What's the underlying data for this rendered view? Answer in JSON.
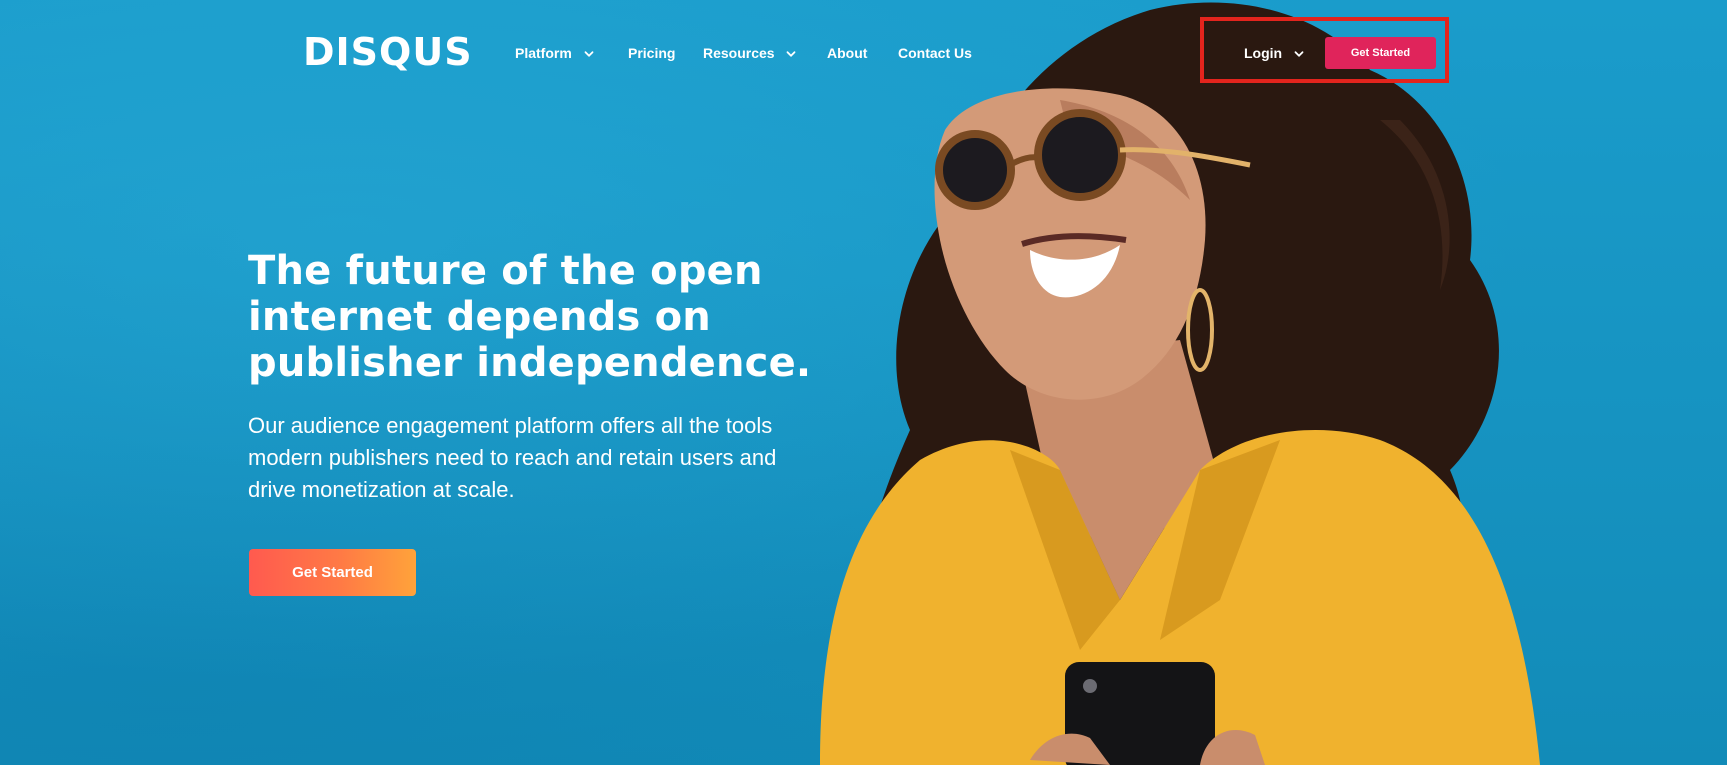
{
  "header": {
    "logo_text": "DISQUS",
    "nav": [
      {
        "label": "Platform",
        "has_dropdown": true
      },
      {
        "label": "Pricing",
        "has_dropdown": false
      },
      {
        "label": "Resources",
        "has_dropdown": true
      },
      {
        "label": "About",
        "has_dropdown": false
      },
      {
        "label": "Contact Us",
        "has_dropdown": false
      }
    ],
    "login_label": "Login",
    "get_started_label": "Get Started"
  },
  "hero": {
    "title_lines": [
      "The future of the open",
      "internet depends on",
      "publisher independence."
    ],
    "subtitle_lines": [
      "Our audience engagement platform offers all the tools",
      "modern publishers need to reach and retain users and",
      "drive monetization at scale."
    ],
    "cta_label": "Get Started"
  },
  "colors": {
    "background": "#1797c4",
    "header_cta": "#e0245b",
    "hero_cta_start": "#ff5a4f",
    "hero_cta_end": "#ffa33a",
    "highlight_outline": "#e3241d",
    "text": "#ffffff"
  },
  "icons": {
    "dropdown": "chevron-down-icon"
  },
  "image": {
    "subject": "hero-photo"
  }
}
